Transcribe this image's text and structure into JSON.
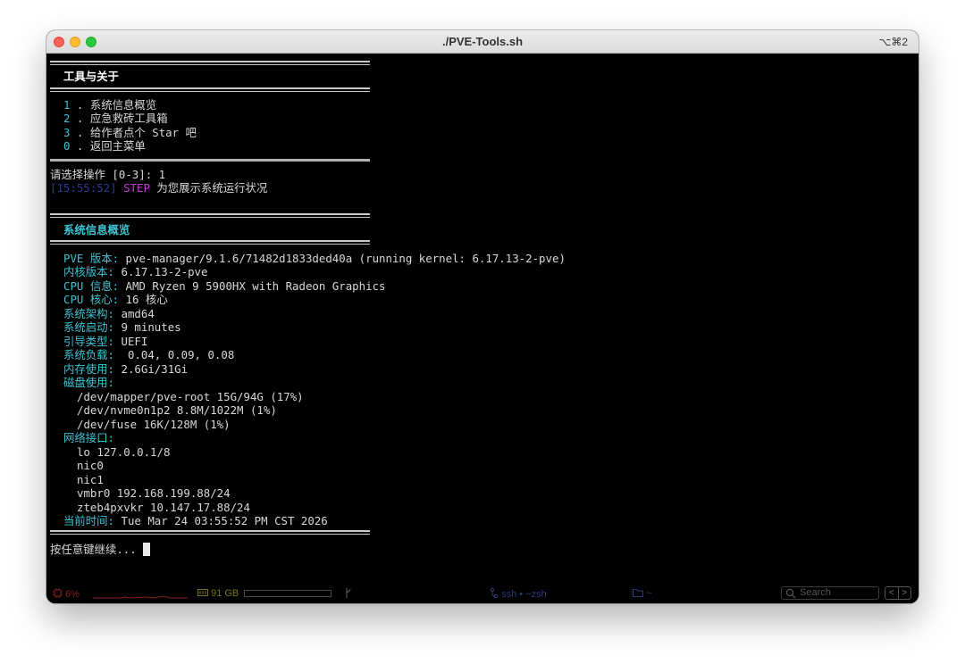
{
  "window": {
    "title": "./PVE-Tools.sh",
    "shortcut": "⌥⌘2"
  },
  "menu": {
    "header": "工具与关于",
    "items": [
      {
        "num": "1",
        "label": " . 系统信息概览"
      },
      {
        "num": "2",
        "label": " . 应急救砖工具箱"
      },
      {
        "num": "3",
        "label": " . 给作者点个 Star 吧"
      },
      {
        "num": "0",
        "label": " . 返回主菜单"
      }
    ]
  },
  "prompt": {
    "text": "请选择操作 [0-3]: 1"
  },
  "log": {
    "time": "[15:55:52]",
    "tag": "STEP",
    "message": " 为您展示系统运行状况"
  },
  "sysinfo": {
    "header": "系统信息概览",
    "fields": [
      {
        "key": "PVE 版本:",
        "value": " pve-manager/9.1.6/71482d1833ded40a (running kernel: 6.17.13-2-pve)"
      },
      {
        "key": "内核版本:",
        "value": " 6.17.13-2-pve"
      },
      {
        "key": "CPU 信息:",
        "value": " AMD Ryzen 9 5900HX with Radeon Graphics"
      },
      {
        "key": "CPU 核心:",
        "value": " 16 核心"
      },
      {
        "key": "系统架构:",
        "value": " amd64"
      },
      {
        "key": "系统启动:",
        "value": " 9 minutes"
      },
      {
        "key": "引导类型:",
        "value": " UEFI"
      },
      {
        "key": "系统负载:",
        "value": "  0.04, 0.09, 0.08"
      },
      {
        "key": "内存使用:",
        "value": " 2.6Gi/31Gi"
      }
    ],
    "disk_label": "磁盘使用:",
    "disks": [
      "/dev/mapper/pve-root 15G/94G (17%)",
      "/dev/nvme0n1p2 8.8M/1022M (1%)",
      "/dev/fuse 16K/128M (1%)"
    ],
    "net_label": "网络接口:",
    "interfaces": [
      "lo 127.0.0.1/8",
      "nic0",
      "nic1",
      "vmbr0 192.168.199.88/24",
      "zteb4pxvkr 10.147.17.88/24"
    ],
    "time_label": "当前时间:",
    "time_value": " Tue Mar 24 03:55:52 PM CST 2026"
  },
  "continue_prompt": "按任意键继续... ",
  "statusbar": {
    "cpu_icon": "cpu-icon",
    "cpu": "6%",
    "mem_icon": "memory-icon",
    "mem": "91 GB",
    "branch_icon": "branch-icon",
    "session_icon": "session-icon",
    "session": "ssh • ~zsh",
    "folder_icon": "folder-icon",
    "folder": "~",
    "search_icon": "search-icon",
    "search_placeholder": "Search",
    "prev": "<",
    "next": ">"
  }
}
